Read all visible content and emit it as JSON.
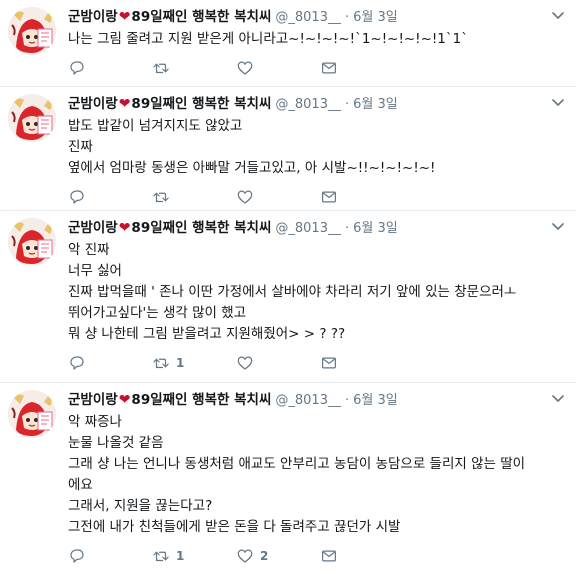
{
  "tweets": [
    {
      "display_name": "군밤이랑",
      "display_name_suffix": "89일째인 행복한 복치씨",
      "handle": "@_8013__",
      "separator": "·",
      "time": "6월 3일",
      "lines": [
        "나는 그림 줄려고 지원 받은게 아니라고~!~!~!~!`1~!~!~!~!1`1`"
      ],
      "reply_count": "",
      "retweet_count": "",
      "like_count": ""
    },
    {
      "display_name": "군밤이랑",
      "display_name_suffix": "89일째인 행복한 복치씨",
      "handle": "@_8013__",
      "separator": "·",
      "time": "6월 3일",
      "lines": [
        "밥도 밥같이 넘겨지지도 않았고",
        "진짜",
        "옆에서 엄마랑 동생은 아빠말 거들고있고, 아 시발~!!~!~!~!~!"
      ],
      "reply_count": "",
      "retweet_count": "",
      "like_count": ""
    },
    {
      "display_name": "군밤이랑",
      "display_name_suffix": "89일째인 행복한 복치씨",
      "handle": "@_8013__",
      "separator": "·",
      "time": "6월 3일",
      "lines": [
        "악 진짜",
        "너무 싫어",
        "진짜 밥먹을때 ' 존나 이딴 가정에서 살바에야 차라리 저기 앞에 있는 창문으러ㅗ",
        "뛰어가고싶다'는 생각 많이 했고",
        "뭐 샹 나한테 그림 받을려고 지원해줬어> > ? ??"
      ],
      "reply_count": "",
      "retweet_count": "1",
      "like_count": ""
    },
    {
      "display_name": "군밤이랑",
      "display_name_suffix": "89일째인 행복한 복치씨",
      "handle": "@_8013__",
      "separator": "·",
      "time": "6월 3일",
      "lines": [
        "악 짜증나",
        "눈물 나올것 같음",
        "그래 샹 나는 언니나 동생처럼 애교도 안부리고 농담이 농담으로 들리지 않는 딸이",
        "에요",
        "그래서, 지원을 끊는다고?",
        "그전에 내가 친척들에게 받은 돈을 다 돌려주고 끊던가 시발"
      ],
      "reply_count": "",
      "retweet_count": "1",
      "like_count": "2"
    }
  ],
  "colors": {
    "text": "#14171a",
    "secondary": "#657786",
    "heart": "#c8102e",
    "divider": "#e6ecf0"
  }
}
